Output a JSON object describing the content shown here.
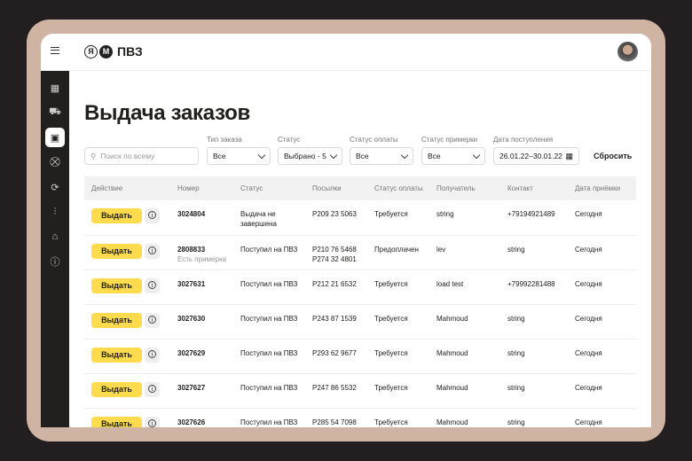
{
  "header": {
    "brand": "ПВЗ",
    "logo_letter": "Я"
  },
  "sidebar": {
    "items": [
      "dashboard",
      "delivery",
      "issue",
      "cart",
      "returns",
      "stats",
      "store",
      "help"
    ]
  },
  "page_title": "Выдача заказов",
  "filters": {
    "search_placeholder": "Поиск по всему",
    "order_type": {
      "label": "Тип заказа",
      "value": "Все"
    },
    "status": {
      "label": "Статус",
      "value": "Выбрано - 5"
    },
    "payment_status": {
      "label": "Статус оплаты",
      "value": "Все"
    },
    "fitting_status": {
      "label": "Статус примерки",
      "value": "Все"
    },
    "arrival_date": {
      "label": "Дата поступления",
      "value": "26.01.22–30.01.22"
    },
    "reset": "Сбросить"
  },
  "table": {
    "columns": [
      "Действие",
      "Номер",
      "Статус",
      "Посылки",
      "Статус оплаты",
      "Получатель",
      "Контакт",
      "Дата приёмки"
    ],
    "action_label": "Выдать",
    "rows": [
      {
        "number": "3024804",
        "note": "",
        "status": "Выдача не завершена",
        "parcels": [
          "P209 23 5063"
        ],
        "payment": "Требуется",
        "recipient": "string",
        "contact": "+79194921489",
        "date": "Сегодня"
      },
      {
        "number": "2808833",
        "note": "Есть примерка",
        "status": "Поступил на ПВЗ",
        "parcels": [
          "P210 76 5468",
          "P274 32 4801"
        ],
        "payment": "Предоплачен",
        "recipient": "lev",
        "contact": "string",
        "date": "Сегодня"
      },
      {
        "number": "3027631",
        "note": "",
        "status": "Поступил на ПВЗ",
        "parcels": [
          "P212 21 6532"
        ],
        "payment": "Требуется",
        "recipient": "load test",
        "contact": "+79992281488",
        "date": "Сегодня"
      },
      {
        "number": "3027630",
        "note": "",
        "status": "Поступил на ПВЗ",
        "parcels": [
          "P243 87 1539"
        ],
        "payment": "Требуется",
        "recipient": "Mahmoud",
        "contact": "string",
        "date": "Сегодня"
      },
      {
        "number": "3027629",
        "note": "",
        "status": "Поступил на ПВЗ",
        "parcels": [
          "P293 62 9677"
        ],
        "payment": "Требуется",
        "recipient": "Mahmoud",
        "contact": "string",
        "date": "Сегодня"
      },
      {
        "number": "3027627",
        "note": "",
        "status": "Поступил на ПВЗ",
        "parcels": [
          "P247 86 5532"
        ],
        "payment": "Требуется",
        "recipient": "Mahmoud",
        "contact": "string",
        "date": "Сегодня"
      },
      {
        "number": "3027626",
        "note": "",
        "status": "Поступил на ПВЗ",
        "parcels": [
          "P285 54 7098"
        ],
        "payment": "Требуется",
        "recipient": "Mahmoud",
        "contact": "string",
        "date": "Сегодня"
      }
    ]
  },
  "colors": {
    "accent": "#ffdb4d",
    "sidebar": "#21201f",
    "frame": "#cfb3a3"
  }
}
